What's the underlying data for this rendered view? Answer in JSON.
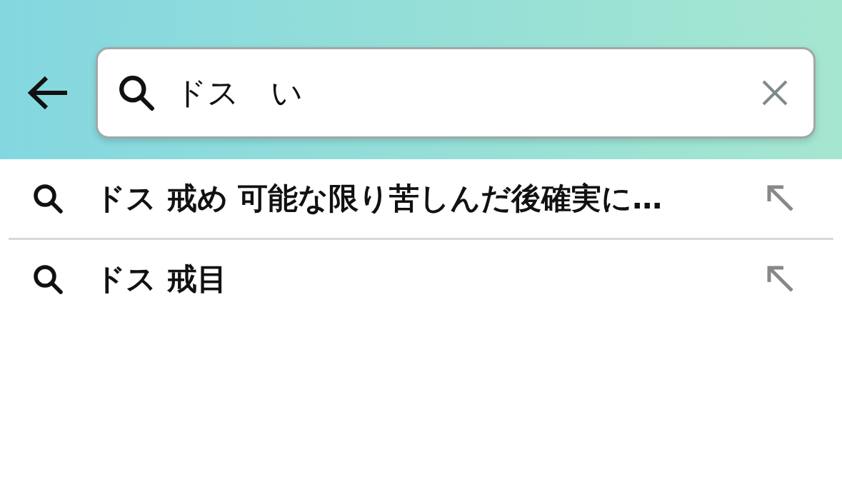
{
  "search": {
    "value": "ドス　い"
  },
  "suggestions": [
    {
      "text": "ドス 戒め 可能な限り苦しんだ後確実に…"
    },
    {
      "text": "ドス 戒目"
    }
  ]
}
